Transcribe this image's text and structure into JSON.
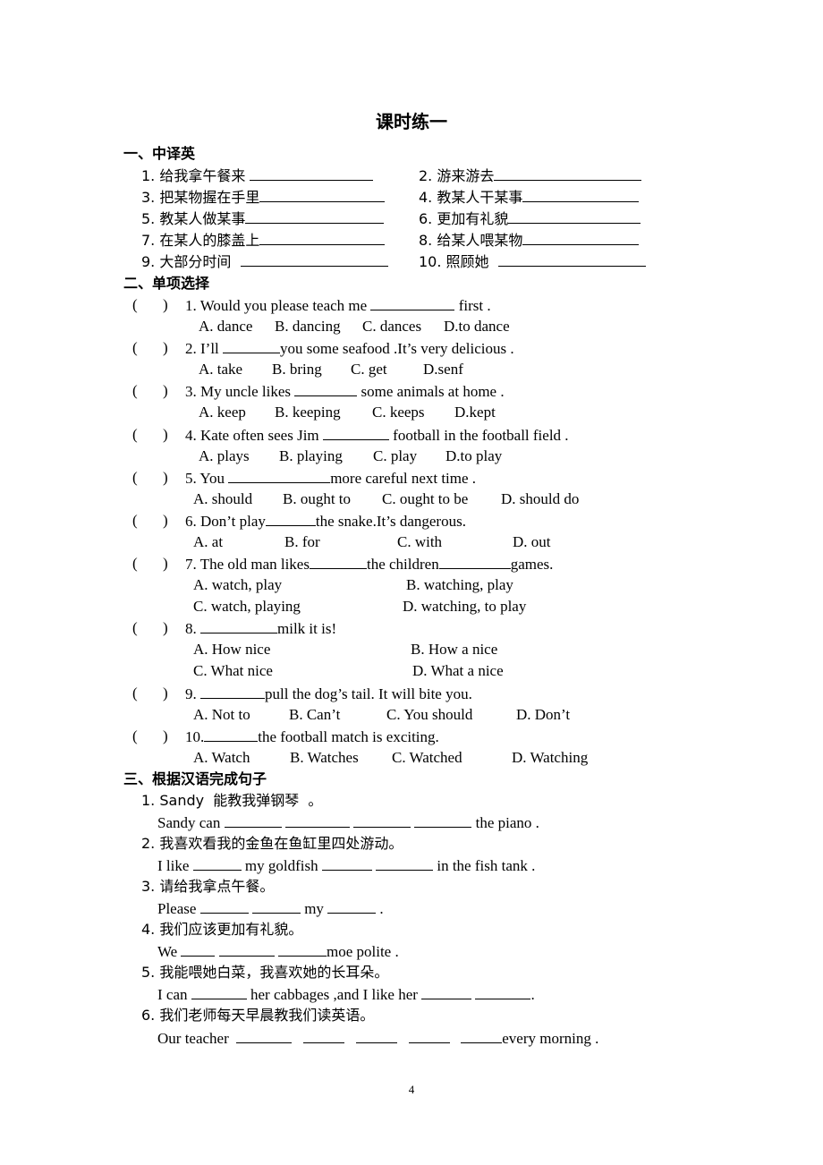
{
  "title": "课时练一",
  "section1": {
    "heading": "一、中译英",
    "items": [
      {
        "num": "1.",
        "text": "给我拿午餐来"
      },
      {
        "num": "2.",
        "text": "游来游去"
      },
      {
        "num": "3.",
        "text": "把某物握在手里"
      },
      {
        "num": "4.",
        "text": "教某人干某事"
      },
      {
        "num": "5.",
        "text": "教某人做某事"
      },
      {
        "num": "6.",
        "text": "更加有礼貌"
      },
      {
        "num": "7.",
        "text": "在某人的膝盖上"
      },
      {
        "num": "8.",
        "text": "给某人喂某物"
      },
      {
        "num": "9.",
        "text": "大部分时间"
      },
      {
        "num": "10.",
        "text": "照顾她"
      }
    ]
  },
  "section2": {
    "heading": "二、单项选择",
    "paren_open": "(",
    "paren_close": ")",
    "questions": [
      {
        "stem_a": "1. Would you please teach me ",
        "stem_b": " first .",
        "options": [
          "A. dance",
          "B. dancing",
          "C. dances",
          "D.to dance"
        ]
      },
      {
        "stem_a": "2. I’ll ",
        "stem_b": "you some seafood .It’s very delicious .",
        "options": [
          "A. take",
          "B. bring",
          "C. get",
          "D.senf"
        ]
      },
      {
        "stem_a": "3. My uncle likes ",
        "stem_b": " some animals at home .",
        "options": [
          "A. keep",
          "B. keeping",
          "C. keeps",
          "D.kept"
        ]
      },
      {
        "stem_a": "4. Kate often sees Jim ",
        "stem_b": " football in the football field .",
        "options": [
          "A. plays",
          "B. playing",
          "C. play",
          "D.to play"
        ]
      },
      {
        "stem_a": "5. You ",
        "stem_b": "more careful next time .",
        "options": [
          "A. should",
          "B. ought to",
          "C. ought to be",
          "D. should do"
        ]
      },
      {
        "stem_a": "6. Don’t play",
        "stem_b": "the snake.It’s dangerous.",
        "options": [
          "A. at",
          "B. for",
          "C. with",
          "D. out"
        ]
      },
      {
        "stem_a": "7. The old man likes",
        "stem_mid": "the children",
        "stem_b": "games.",
        "options": [
          "A. watch, play",
          "B. watching, play",
          "C. watch, playing",
          "D. watching, to play"
        ]
      },
      {
        "stem_a": "8. ",
        "stem_b": "milk it is!",
        "options": [
          "A. How nice",
          "B. How a nice",
          "C. What nice",
          "D. What a nice"
        ]
      },
      {
        "stem_a": "9. ",
        "stem_b": "pull the dog’s tail. It will bite you.",
        "options": [
          "A. Not to",
          "B. Can’t",
          "C. You should",
          "D. Don’t"
        ]
      },
      {
        "stem_a": "10.",
        "stem_b": "the football match is exciting.",
        "options": [
          "A. Watch",
          "B. Watches",
          "C. Watched",
          "D. Watching"
        ]
      }
    ]
  },
  "section3": {
    "heading": "三、根据汉语完成句子",
    "items": [
      {
        "cn": "1. Sandy  能教我弹钢琴  。",
        "en_parts": [
          "Sandy can ",
          " ",
          " ",
          " ",
          " the piano ."
        ]
      },
      {
        "cn": "2. 我喜欢看我的金鱼在鱼缸里四处游动。",
        "en_parts": [
          "I like ",
          " my goldfish ",
          " ",
          " in the fish tank ."
        ]
      },
      {
        "cn": "3. 请给我拿点午餐。",
        "en_parts": [
          "Please ",
          " ",
          " my ",
          " ."
        ]
      },
      {
        "cn": "4. 我们应该更加有礼貌。",
        "en_parts": [
          "We ",
          " ",
          " ",
          "moe polite ."
        ]
      },
      {
        "cn": "5. 我能喂她白菜，我喜欢她的长耳朵。",
        "en_parts": [
          "I can ",
          " her cabbages ,and I like her ",
          " ",
          "."
        ]
      },
      {
        "cn": "6. 我们老师每天早晨教我们读英语。",
        "en_parts": [
          "Our teacher  ",
          "   ",
          "   ",
          "   ",
          "   ",
          "every morning ."
        ]
      }
    ]
  },
  "page_number": "4"
}
